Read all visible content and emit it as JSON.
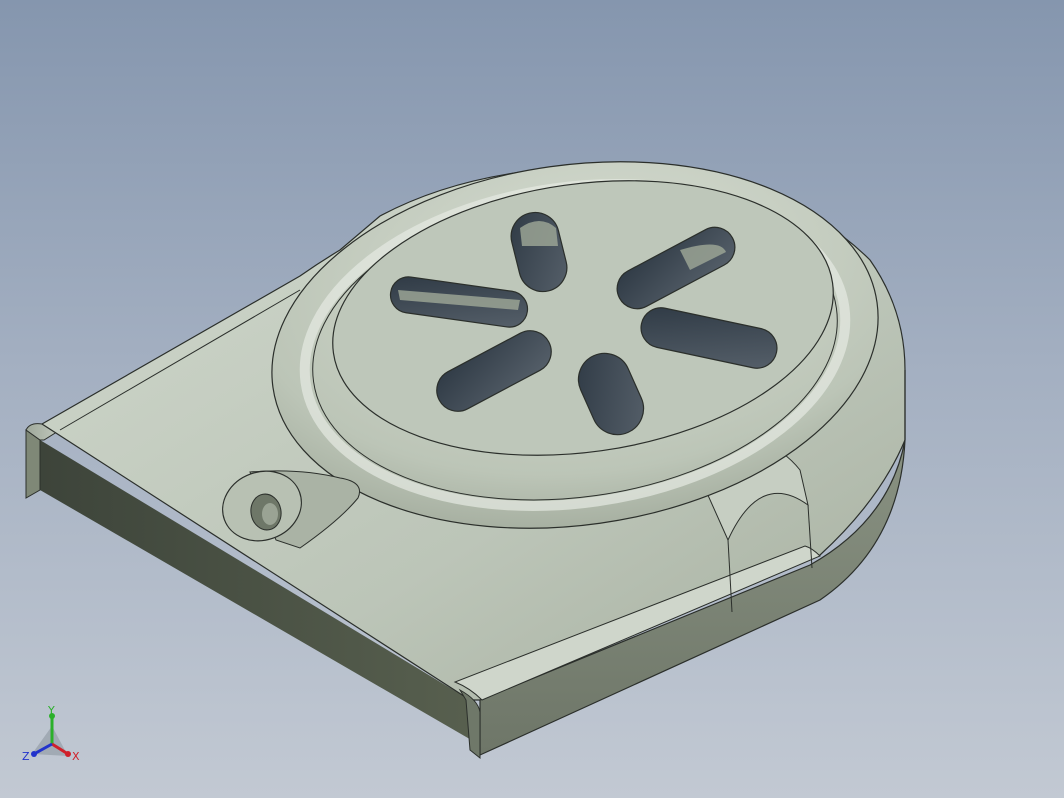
{
  "viewport": {
    "background_top": "#8596ae",
    "background_bottom": "#c2c9d3"
  },
  "model": {
    "body_color": "#bfc8bb",
    "edge_color": "#2b2f2b",
    "slot_count": 6
  },
  "triad": {
    "x_label": "X",
    "y_label": "Y",
    "z_label": "Z",
    "x_color": "#d0202a",
    "y_color": "#2bb02b",
    "z_color": "#2233cc"
  }
}
